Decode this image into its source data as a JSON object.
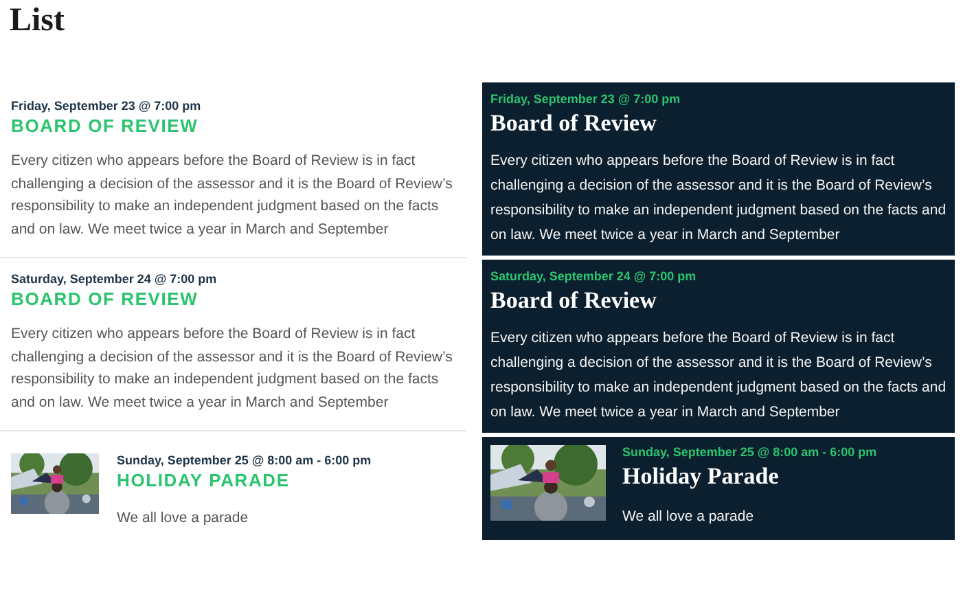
{
  "page_title": "List",
  "light_list": [
    {
      "kind": "text",
      "date": "Friday, September 23 @ 7:00 pm",
      "title": "BOARD OF REVIEW",
      "description": "Every citizen who appears before the Board of Review is in fact challenging a decision of the assessor and it is the Board of Review’s responsibility to make an independent judgment based on the facts and on law.  We meet twice a year in March and September"
    },
    {
      "kind": "text",
      "date": "Saturday, September 24 @ 7:00 pm",
      "title": "BOARD OF REVIEW",
      "description": "Every citizen who appears before the Board of Review is in fact challenging a decision of the assessor and it is the Board of Review’s responsibility to make an independent judgment based on the facts and on law.  We meet twice a year in March and September"
    },
    {
      "kind": "picture",
      "date": "Sunday, September 25 @ 8:00 am - 6:00 pm",
      "title": "HOLIDAY PARADE",
      "description": "We all love a parade"
    }
  ],
  "dark_list": [
    {
      "kind": "text",
      "date": "Friday, September 23 @ 7:00 pm",
      "title": "Board of Review",
      "description": "Every citizen who appears before the Board of Review is in fact challenging a decision of the assessor and it is the Board of Review’s responsibility to make an independent judgment based on the facts and on law.  We meet twice a year in March and September"
    },
    {
      "kind": "text",
      "date": "Saturday, September 24 @ 7:00 pm",
      "title": "Board of Review",
      "description": "Every citizen who appears before the Board of Review is in fact challenging a decision of the assessor and it is the Board of Review’s responsibility to make an independent judgment based on the facts and on law.  We meet twice a year in March and September"
    },
    {
      "kind": "picture",
      "date": "Sunday, September 25 @ 8:00 am - 6:00 pm",
      "title": "Holiday Parade",
      "description": "We all love a parade"
    }
  ]
}
